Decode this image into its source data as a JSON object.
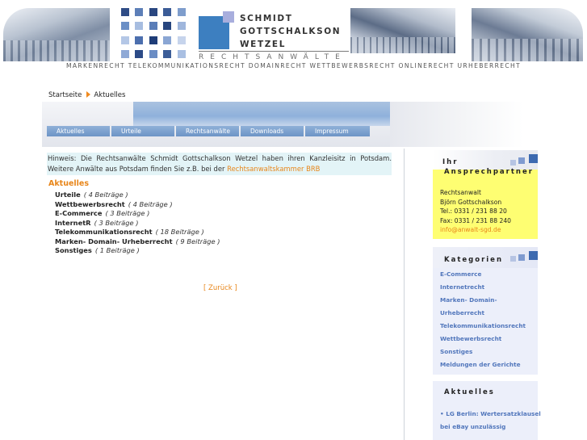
{
  "header": {
    "logo_lines": [
      "SCHMIDT",
      "GOTTSCHALKSON",
      "WETZEL"
    ],
    "logo_subtitle": "RECHTSANWÄLTE",
    "practice_areas": "MARKENRECHT TELEKOMMUNIKATIONSRECHT DOMAINRECHT WETTBEWERBSRECHT ONLINERECHT URHEBERRECHT"
  },
  "breadcrumb": {
    "home": "Startseite",
    "current": "Aktuelles"
  },
  "nav": {
    "tabs": [
      "Aktuelles",
      "Urteile",
      "Rechtsanwälte",
      "Downloads",
      "Impressum"
    ]
  },
  "notice": {
    "text": "Hinweis: Die Rechtsanwälte Schmidt Gottschalkson Wetzel haben ihren Kanzleisitz in Potsdam. Weitere Anwälte aus Potsdam finden Sie z.B. bei der ",
    "link": "Rechtsanwaltskammer BRB"
  },
  "main": {
    "section_title": "Aktuelles",
    "categories": [
      {
        "name": "Urteile",
        "count": "( 4 Beiträge )"
      },
      {
        "name": "Wettbewerbsrecht",
        "count": "( 4 Beiträge )"
      },
      {
        "name": "E-Commerce",
        "count": "( 3 Beiträge )"
      },
      {
        "name": "InternetR",
        "count": "( 3 Beiträge )"
      },
      {
        "name": "Telekommunikationsrecht",
        "count": "( 18 Beiträge )"
      },
      {
        "name": "Marken- Domain- Urheberrecht",
        "count": "( 9 Beiträge )"
      },
      {
        "name": "Sonstiges",
        "count": "( 1 Beiträge )"
      }
    ],
    "back_link": "[ Zurück ]"
  },
  "sidebar": {
    "contact": {
      "title_1": "Ihr",
      "title_2": "Ansprechpartner",
      "role": "Rechtsanwalt",
      "name": "Björn Gottschalkson",
      "tel": "Tel.: 0331 / 231 88 20",
      "fax": "Fax: 0331 / 231 88 240",
      "email": "info@anwalt-sgd.de"
    },
    "kategorien": {
      "title": "Kategorien",
      "items": [
        "E-Commerce",
        "Internetrecht",
        "Marken- Domain-",
        "Urheberrecht",
        "Telekommunikationsrecht",
        "Wettbewerbsrecht",
        "Sonstiges",
        "Meldungen der Gerichte"
      ]
    },
    "aktuelles": {
      "title": "Aktuelles",
      "item": "LG Berlin: Wertersatzklausel bei eBay unzulässig"
    }
  },
  "colors": {
    "accent_orange": "#e8861a",
    "link_blue": "#5277bc",
    "logo_blue": "#3d7fc0",
    "contact_yellow": "#fefe72"
  }
}
